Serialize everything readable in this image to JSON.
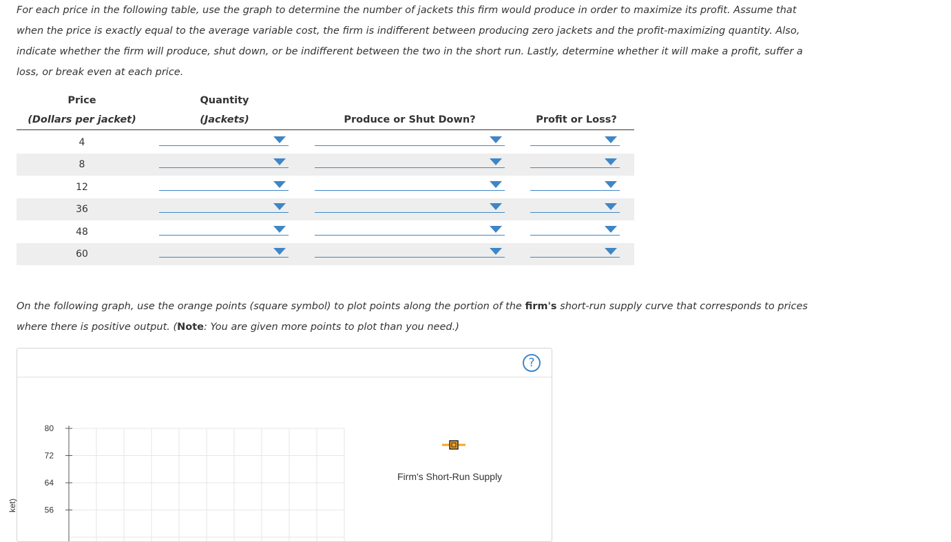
{
  "intro": {
    "text": "For each price in the following table, use the graph to determine the number of jackets this firm would produce in order to maximize its profit. Assume that when the price is exactly equal to the average variable cost, the firm is indifferent between producing zero jackets and the profit-maximizing quantity. Also, indicate whether the firm will produce, shut down, or be indifferent between the two in the short run. Lastly, determine whether it will make a profit, suffer a loss, or break even at each price."
  },
  "table": {
    "col_price_title": "Price",
    "col_price_unit": "(Dollars per jacket)",
    "col_qty_title": "Quantity",
    "col_qty_unit": "(Jackets)",
    "col_produce": "Produce or Shut Down?",
    "col_profit": "Profit or Loss?",
    "rows": [
      {
        "price": "4",
        "quantity": "",
        "produce": "",
        "profit": ""
      },
      {
        "price": "8",
        "quantity": "",
        "produce": "",
        "profit": ""
      },
      {
        "price": "12",
        "quantity": "",
        "produce": "",
        "profit": ""
      },
      {
        "price": "36",
        "quantity": "",
        "produce": "",
        "profit": ""
      },
      {
        "price": "48",
        "quantity": "",
        "produce": "",
        "profit": ""
      },
      {
        "price": "60",
        "quantity": "",
        "produce": "",
        "profit": ""
      }
    ]
  },
  "graph_instructions": {
    "part1": "On the following graph, use the orange points (square symbol) to plot points along the portion of the ",
    "firm_bold": "firm's",
    "part2": " short-run supply curve that corresponds to prices where there is positive output. (",
    "note_bold": "Note",
    "part3": ": You are given more points to plot than you need.)"
  },
  "graph": {
    "help_label": "?",
    "y_axis_label_partial": "ket)",
    "y_ticks": [
      "80",
      "72",
      "64",
      "56"
    ],
    "legend_label": "Firm's Short-Run Supply",
    "colors": {
      "accent": "#3f86c6",
      "orange": "#f5a623",
      "grid": "#e6e6e6"
    }
  }
}
